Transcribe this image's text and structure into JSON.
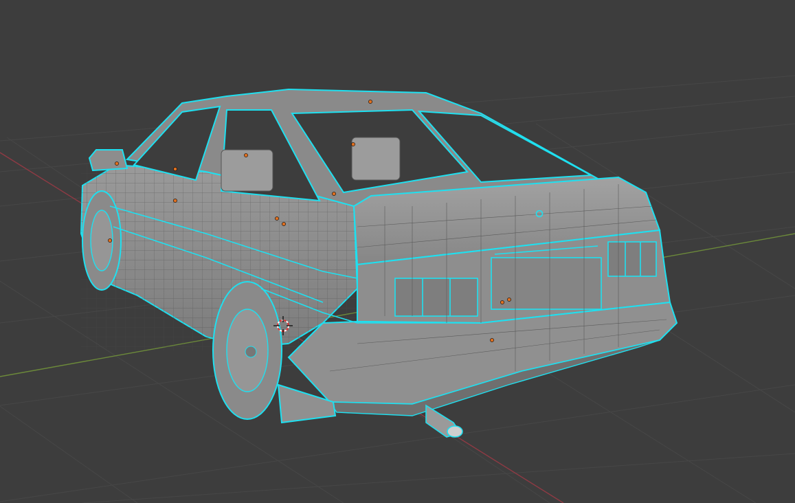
{
  "viewport": {
    "mode": "edit-mode-mesh-selected",
    "background_color": "#3d3d3d",
    "grid_color": "#4a4a4a",
    "x_axis_color": "#9a3c45",
    "y_axis_color": "#6e8c3c",
    "body_fill_color": "#8c8c8c",
    "body_shadow_color": "#6e6e6e",
    "wire_color": "#3a3a3a",
    "selection_edge_color": "#1fe0f0",
    "vertex_marker_color": "#e07020",
    "cursor_icon": "3d-cursor-icon",
    "object": "car-mesh"
  }
}
